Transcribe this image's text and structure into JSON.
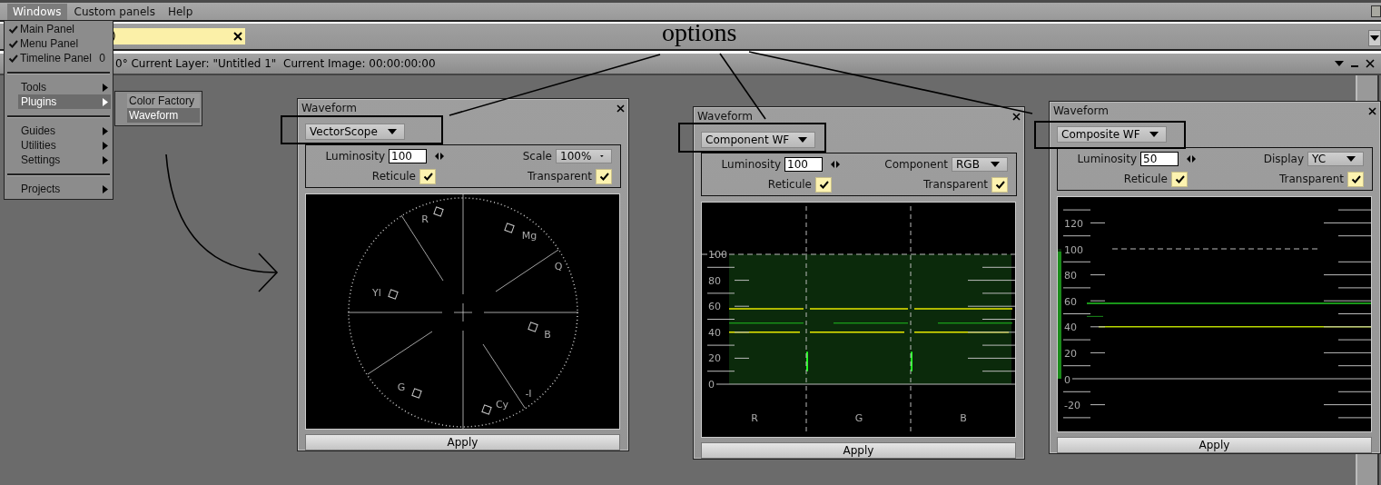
{
  "menu_bar": {
    "items": [
      {
        "label": "Windows",
        "selected": true
      },
      {
        "label": "Custom panels",
        "selected": false
      },
      {
        "label": "Help",
        "selected": false
      }
    ]
  },
  "toolbar": {
    "field": {
      "value": ")"
    }
  },
  "panel": {
    "status": "0° Current Layer: \"Untitled 1\"  Current Image: 00:00:00:00"
  },
  "windows_menu": {
    "items": [
      {
        "kind": "check",
        "label": "Main Panel",
        "checked": true
      },
      {
        "kind": "check",
        "label": "Menu Panel",
        "checked": true
      },
      {
        "kind": "check",
        "label": "Timeline Panel",
        "checked": true,
        "shortcut": "0"
      },
      {
        "kind": "separator"
      },
      {
        "kind": "submenu",
        "label": "Tools",
        "selected": false
      },
      {
        "kind": "submenu",
        "label": "Plugins",
        "selected": true
      },
      {
        "kind": "separator"
      },
      {
        "kind": "submenu",
        "label": "Guides",
        "selected": false
      },
      {
        "kind": "submenu",
        "label": "Utilities",
        "selected": false
      },
      {
        "kind": "submenu",
        "label": "Settings",
        "selected": false
      },
      {
        "kind": "separator"
      },
      {
        "kind": "submenu",
        "label": "Projects",
        "selected": false
      }
    ]
  },
  "plugins_submenu": {
    "items": [
      {
        "label": "Color Factory",
        "selected": false
      },
      {
        "label": "Waveform",
        "selected": true
      }
    ]
  },
  "annotation": {
    "label": "options"
  },
  "dialogs": [
    {
      "title": "Waveform",
      "kind": "vectorscope",
      "mode": "VectorScope",
      "luminosity": {
        "label": "Luminosity",
        "value": "100"
      },
      "option": {
        "label": "Scale",
        "value": "100%"
      },
      "reticule": {
        "label": "Reticule",
        "checked": true
      },
      "transparent": {
        "label": "Transparent",
        "checked": true
      },
      "scope": {
        "labels": [
          "R",
          "Mg",
          "Q",
          "Yl",
          "B",
          "G",
          "Cy",
          "-I"
        ]
      },
      "apply": "Apply"
    },
    {
      "title": "Waveform",
      "kind": "component",
      "mode": "Component WF",
      "luminosity": {
        "label": "Luminosity",
        "value": "100"
      },
      "option": {
        "label": "Component",
        "value": "RGB"
      },
      "reticule": {
        "label": "Reticule",
        "checked": true
      },
      "transparent": {
        "label": "Transparent",
        "checked": true
      },
      "scope": {
        "scale_labels": [
          "100",
          "80",
          "60",
          "40",
          "20",
          "0"
        ],
        "channel_labels": [
          "R",
          "G",
          "B"
        ]
      },
      "apply": "Apply"
    },
    {
      "title": "Waveform",
      "kind": "composite",
      "mode": "Composite WF",
      "luminosity": {
        "label": "Luminosity",
        "value": "50"
      },
      "option": {
        "label": "Display",
        "value": "YC"
      },
      "reticule": {
        "label": "Reticule",
        "checked": true
      },
      "transparent": {
        "label": "Transparent",
        "checked": true
      },
      "scope": {
        "scale_labels": [
          "120",
          "100",
          "80",
          "60",
          "40",
          "20",
          "0",
          "-20"
        ]
      },
      "apply": "Apply"
    }
  ]
}
